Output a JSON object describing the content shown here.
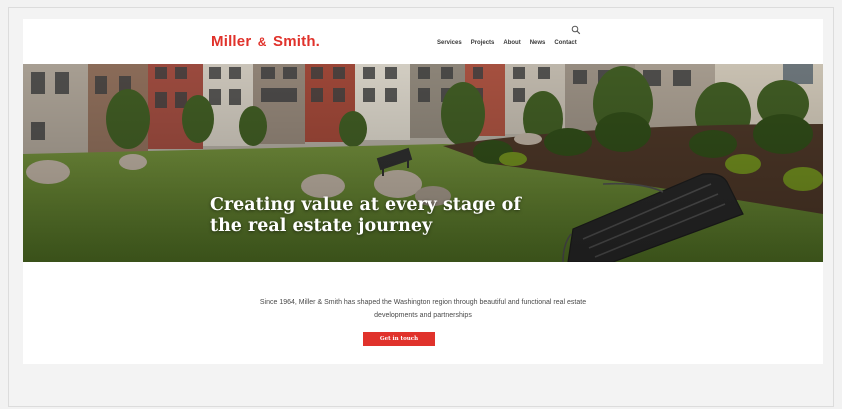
{
  "brand": {
    "name": "Miller & Smith.",
    "part1": "Miller",
    "amp": "&",
    "part2": "Smith.",
    "color": "#e0322b"
  },
  "nav": {
    "items": [
      {
        "label": "Services"
      },
      {
        "label": "Projects"
      },
      {
        "label": "About"
      },
      {
        "label": "News"
      },
      {
        "label": "Contact"
      }
    ],
    "search_icon": "search-icon"
  },
  "hero": {
    "headline": "Creating value at every stage of the real estate journey"
  },
  "intro": {
    "text": "Since 1964, Miller & Smith has shaped the Washington region through beautiful and functional real estate developments and partnerships"
  },
  "cta": {
    "label": "Get in touch",
    "color": "#e0322b"
  }
}
